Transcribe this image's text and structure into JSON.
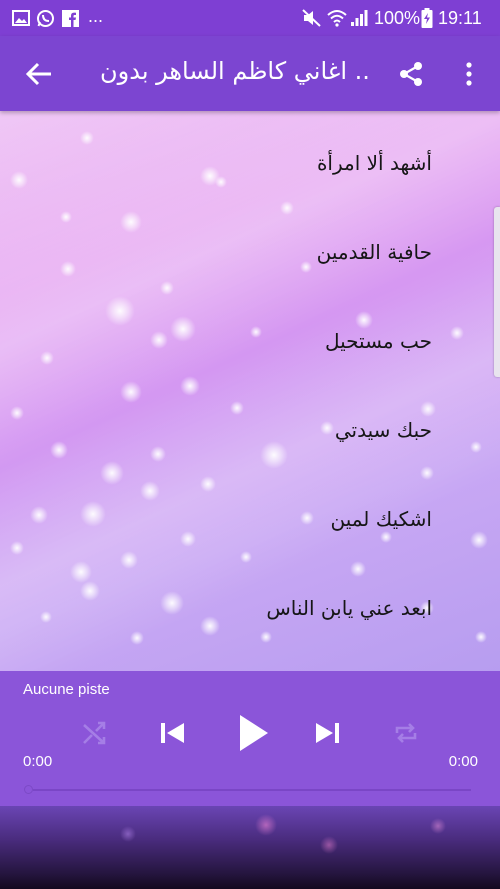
{
  "status_bar": {
    "more_notifications": "...",
    "battery_percent": "100%",
    "time": "19:11"
  },
  "app_bar": {
    "title": "اغاني كاظم الساهر بدون ...",
    "back_icon": "arrow-back-icon",
    "share_icon": "share-icon",
    "menu_icon": "more-vert-icon"
  },
  "songs": [
    "أشهد ألا امرأة",
    "حافية القدمين",
    "حب مستحيل",
    "حبك سيدتي",
    "اشكيك لمين",
    "ابعد عني يابن الناس"
  ],
  "player": {
    "track": "Aucune piste",
    "current_time": "0:00",
    "duration": "0:00",
    "progress": 0,
    "controls": [
      "shuffle-icon",
      "skip-previous-icon",
      "play-icon",
      "skip-next-icon",
      "repeat-icon"
    ]
  },
  "colors": {
    "status_bar": "#7e3fd3",
    "app_bar": "#7c45d1",
    "player": "#8b55d9",
    "dim_icon": "#a57ee6"
  }
}
